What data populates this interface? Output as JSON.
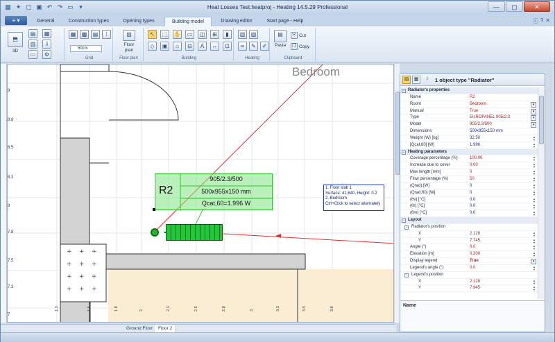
{
  "window": {
    "title": "Heat Losses Test.heatproj - Heating 14.5.29 Professional",
    "qat_icons": [
      "grid-icon",
      "wand-icon",
      "new-icon",
      "save-icon",
      "undo-icon",
      "redo-icon",
      "open-icon",
      "down-icon"
    ]
  },
  "tabs": [
    "General",
    "Construction types",
    "Opening types",
    "Building model",
    "Drawing editor",
    "Start page - Help"
  ],
  "active_tab": "Building model",
  "ribbon": {
    "groups": [
      "Grid",
      "Floor plan",
      "Building",
      "Heating",
      "Clipboard"
    ],
    "grid_value": "50cm",
    "view_3d_label": "3D",
    "floor_plan_label": "Floor\nplan",
    "paste_label": "Paste",
    "cut_label": "Cut",
    "copy_label": "Copy"
  },
  "drawing": {
    "room_name": "Bedroom",
    "radiator_label": "R2",
    "legend_lines": [
      "905/2.3/500",
      "500x955x150 mm",
      "Qcat,60=1.996 W"
    ],
    "tooltip_lines": [
      "1. Floor slab 1",
      "Surface: 41,840, Height: 0,2",
      "2. Bedroom",
      "Ctrl+Click to select alternately"
    ],
    "y_ticks": [
      "9",
      "8.8",
      "8.5",
      "8.3",
      "8",
      "7.8",
      "7.5",
      "7.3",
      "7"
    ],
    "x_ticks": [
      "1.3",
      "1.5",
      "1.8",
      "2",
      "2.3",
      "2.5",
      "2.8",
      "3",
      "3.3",
      "3.5",
      "3.8"
    ],
    "floor_tabs": [
      "Ground Floor",
      "Floor 2"
    ]
  },
  "panel": {
    "header": "1 object type  \"Radiator\"",
    "rows": [
      {
        "type": "section",
        "name": "Radiator's properties"
      },
      {
        "name": "Name",
        "value": "R2"
      },
      {
        "name": "Room",
        "value": "Bedroom",
        "control": "dd"
      },
      {
        "name": "Manual",
        "value": "True",
        "control": "dd"
      },
      {
        "name": "Type",
        "value": "EUROPANEL 905/2.3",
        "control": "dd"
      },
      {
        "name": "Model",
        "value": "905/2.3/500",
        "control": "dd"
      },
      {
        "name": "Dimensions",
        "value": "500x955x150 mm",
        "blue": true
      },
      {
        "name": "Weight (W) [kg]",
        "value": "32.50",
        "blue": true,
        "control": "spin"
      },
      {
        "name": "[Qcat,60] [W]",
        "value": "1.996",
        "blue": true,
        "control": "spin"
      },
      {
        "type": "section",
        "name": "Heating parameters"
      },
      {
        "name": "Coverage percentage (%)",
        "value": "100.00",
        "control": "spin"
      },
      {
        "name": "Increase due to cover",
        "value": "0.00",
        "control": "spin"
      },
      {
        "name": "Max length [mm]",
        "value": "0",
        "control": "spin"
      },
      {
        "name": "Flow percentage (%)",
        "value": "50",
        "control": "spin"
      },
      {
        "name": "(Qrad) [W]",
        "value": "0",
        "blue": true,
        "control": "spin"
      },
      {
        "name": "(Qrad,60) [W]",
        "value": "0",
        "blue": true,
        "control": "spin"
      },
      {
        "name": "(θv) [°C]",
        "value": "0.0",
        "blue": true,
        "control": "spin"
      },
      {
        "name": "(θr) [°C]",
        "value": "0.0",
        "blue": true,
        "control": "spin"
      },
      {
        "name": "(θm) [°C]",
        "value": "0.0",
        "blue": true,
        "control": "spin"
      },
      {
        "type": "section",
        "name": "Layout"
      },
      {
        "type": "subsection",
        "name": "Radiator's position"
      },
      {
        "name": "X",
        "value": "2.128",
        "indent": true,
        "control": "spin"
      },
      {
        "name": "Y",
        "value": "7.745",
        "indent": true,
        "control": "spin"
      },
      {
        "name": "Angle (°)",
        "value": "0.0",
        "control": "spin"
      },
      {
        "name": "Elevation [m]",
        "value": "0.200",
        "control": "spin"
      },
      {
        "name": "Display legend",
        "value": "True",
        "bold": true,
        "control": "dd"
      },
      {
        "name": "Legend's angle (°)",
        "value": "0.0",
        "control": "spin"
      },
      {
        "type": "subsection",
        "name": "Legend's position"
      },
      {
        "name": "X",
        "value": "2.128",
        "indent": true,
        "control": "spin"
      },
      {
        "name": "Y",
        "value": "7.945",
        "indent": true,
        "control": "spin"
      }
    ],
    "desc_title": "Name"
  },
  "colors": {
    "accent": "#2d5b9e",
    "legend_fill": "#82e682",
    "radiator": "#21c83c",
    "red_line": "#e8312a"
  }
}
